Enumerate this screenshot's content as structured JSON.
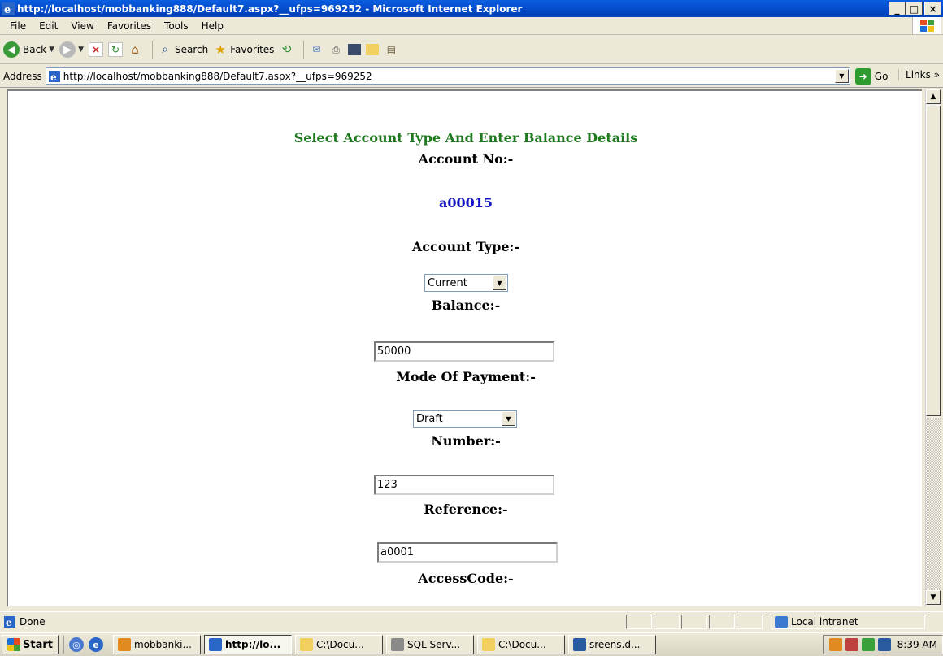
{
  "window": {
    "title": "http://localhost/mobbanking888/Default7.aspx?__ufps=969252 - Microsoft Internet Explorer",
    "minimize": "_",
    "maximize": "□",
    "close": "×"
  },
  "menubar": {
    "items": [
      "File",
      "Edit",
      "View",
      "Favorites",
      "Tools",
      "Help"
    ]
  },
  "toolbar": {
    "back_label": "Back",
    "search_label": "Search",
    "favorites_label": "Favorites"
  },
  "address": {
    "label": "Address",
    "url": "http://localhost/mobbanking888/Default7.aspx?__ufps=969252",
    "go_label": "Go",
    "links_label": "Links »"
  },
  "form": {
    "heading": "Select Account Type And Enter Balance Details",
    "account_no_label": "Account No:-",
    "account_no_value": "a00015",
    "account_type_label": "Account Type:-",
    "account_type_value": "Current",
    "balance_label": "Balance:-",
    "balance_value": "50000",
    "mode_label": "Mode Of Payment:-",
    "mode_value": "Draft",
    "number_label": "Number:-",
    "number_value": "123",
    "reference_label": "Reference:-",
    "reference_value": "a0001",
    "accesscode_label": "AccessCode:-"
  },
  "statusbar": {
    "status": "Done",
    "zone": "Local intranet"
  },
  "taskbar": {
    "start_label": "Start",
    "tasks": [
      "mobbanki...",
      "http://lo...",
      "C:\\Docu...",
      "SQL Serv...",
      "C:\\Docu...",
      "sreens.d..."
    ],
    "active_index": 1,
    "clock": "8:39 AM"
  },
  "colors": {
    "heading": "#1f7a1f",
    "account_value": "#1515c0",
    "titlebar": "#0650d0"
  }
}
